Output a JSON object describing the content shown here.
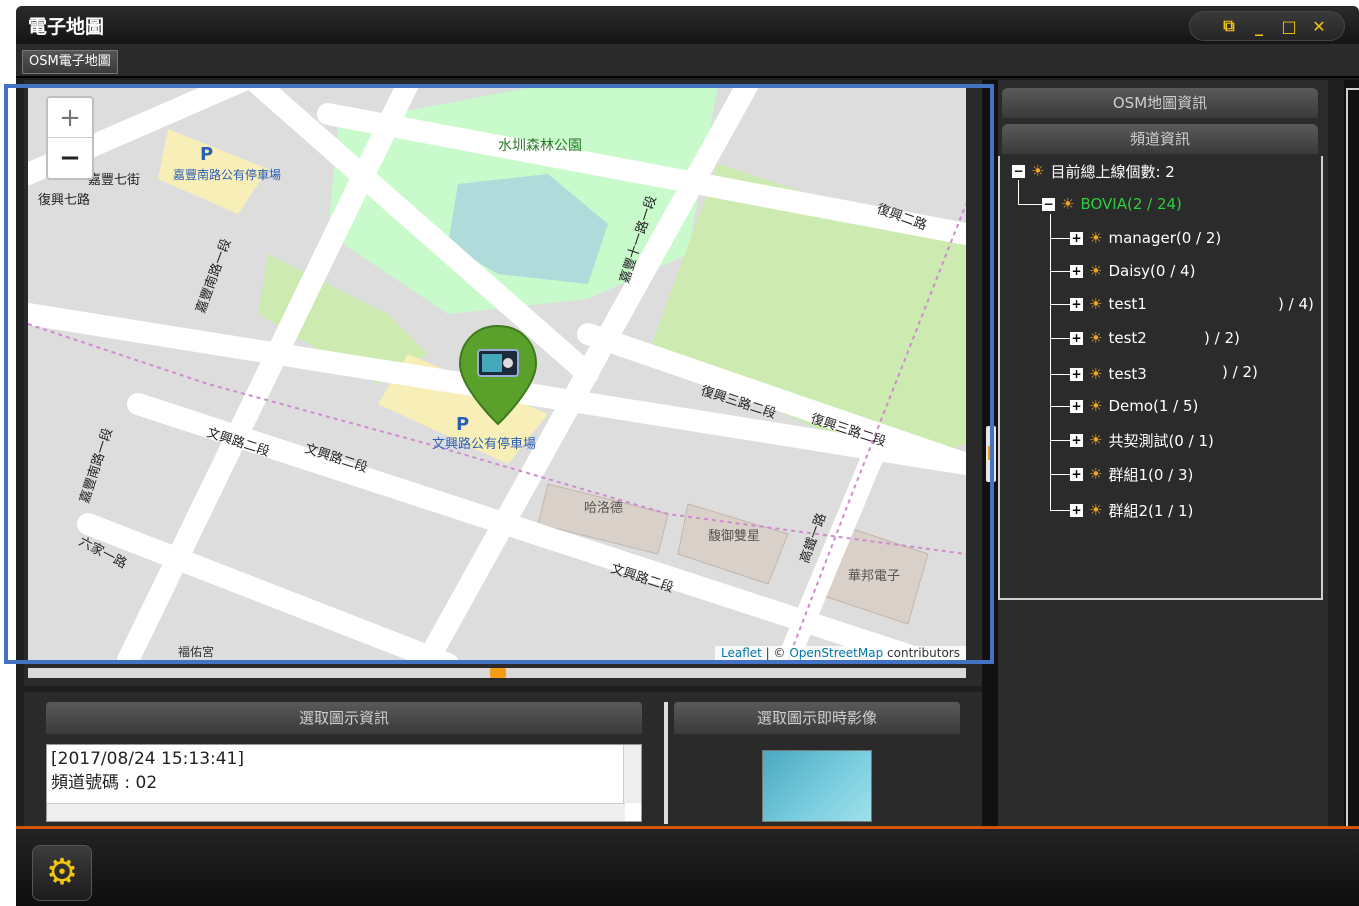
{
  "window": {
    "title": "電子地圖",
    "controls": [
      "⧉",
      "_",
      "□",
      "✕"
    ]
  },
  "tabs": [
    {
      "label": "OSM電子地圖"
    }
  ],
  "map": {
    "zoom_in": "+",
    "zoom_out": "−",
    "attribution_leaflet": "Leaflet",
    "attribution_sep": " | © ",
    "attribution_osm": "OpenStreetMap",
    "attribution_suffix": " contributors",
    "labels": {
      "park": "水圳森林公園",
      "parking_top": "嘉豐南路公有停車場",
      "parking_main": "文興路公有停車場",
      "road_fuxing7": "復興七路",
      "road_jiafeng7": "嘉豐七街",
      "road_fuxing2": "復興二路",
      "road_fuxing3a": "復興三路二段",
      "road_fuxing3b": "復興三路二段",
      "road_wenxing_a": "文興路二段",
      "road_wenxing_b": "文興路二段",
      "road_wenxing_c": "文興路二段",
      "road_jiafeng10": "嘉豐十一路一段",
      "road_jiafengS": "嘉豐南路一段",
      "road_jiafengS2": "嘉豐南路一段",
      "road_liujia": "六家一路",
      "road_gaotie": "高鐵一路",
      "bldg_halo": "哈洛德",
      "bldg_yuyu": "馥御雙星",
      "bldg_huabang": "華邦電子",
      "temple": "褔佑宮",
      "parking_icon": "P"
    }
  },
  "right_panel": {
    "osm_info_header": "OSM地圖資訊",
    "channel_info_header": "頻道資訊",
    "tree": {
      "root": "目前總上線個數: 2",
      "group": "BOVIA(2 / 24)",
      "children": [
        "manager(0 / 2)",
        "Daisy(0 / 4)",
        "test1",
        "test2",
        "test3",
        "Demo(1 / 5)",
        "共契測試(0 / 1)",
        "群組1(0 / 3)",
        "群組2(1 / 1)"
      ],
      "stray_counts": [
        ") / 4)",
        ") / 2)",
        ") / 2)"
      ]
    }
  },
  "bottom": {
    "info_header": "選取圖示資訊",
    "video_header": "選取圖示即時影像",
    "info_lines": [
      "[2017/08/24 15:13:41]",
      "頻道號碼 : 02"
    ]
  },
  "footer": {
    "settings_icon": "gear-icon"
  },
  "colors": {
    "accent": "#f39c12",
    "tree_green": "#2ecc40",
    "highlight": "#4472c4",
    "marker_green": "#5aa12b"
  }
}
